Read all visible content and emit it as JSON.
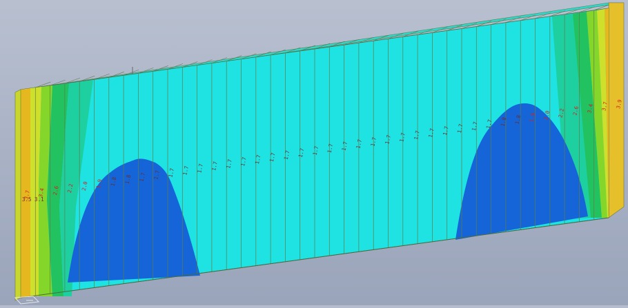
{
  "viewport": {
    "panel_count": 40,
    "colors": {
      "background": "#a9b2c6",
      "low_blue": "#1565d8",
      "cyan": "#1fe2e2",
      "cyan_light": "#34e9df",
      "teal_green": "#1ecfa0",
      "green": "#21c25f",
      "lime": "#7fd62a",
      "yellow": "#d8dc2b",
      "orange": "#f0b21e",
      "edge_line": "#6a7a3a",
      "label_dark": "#6b2c2c",
      "label_red": "#d42020"
    }
  },
  "result_labels": {
    "left_edge": "3.5 3.1",
    "sequence": [
      "3.7",
      "3.4",
      "2.6",
      "2.2",
      "2.0",
      "1.9",
      "1.8",
      "1.8",
      "1.7",
      "1.7",
      "1.7",
      "1.7",
      "1.7",
      "1.7",
      "1.7",
      "1.7",
      "1.7",
      "1.7",
      "1.7",
      "1.7",
      "1.7",
      "1.7",
      "1.7",
      "1.7",
      "1.7",
      "1.7",
      "1.7",
      "1.7",
      "1.7",
      "1.7",
      "1.7",
      "1.7",
      "1.7",
      "1.8",
      "1.8",
      "1.9",
      "2.0",
      "2.2",
      "2.6",
      "3.4",
      "3.7",
      "3.9"
    ]
  }
}
